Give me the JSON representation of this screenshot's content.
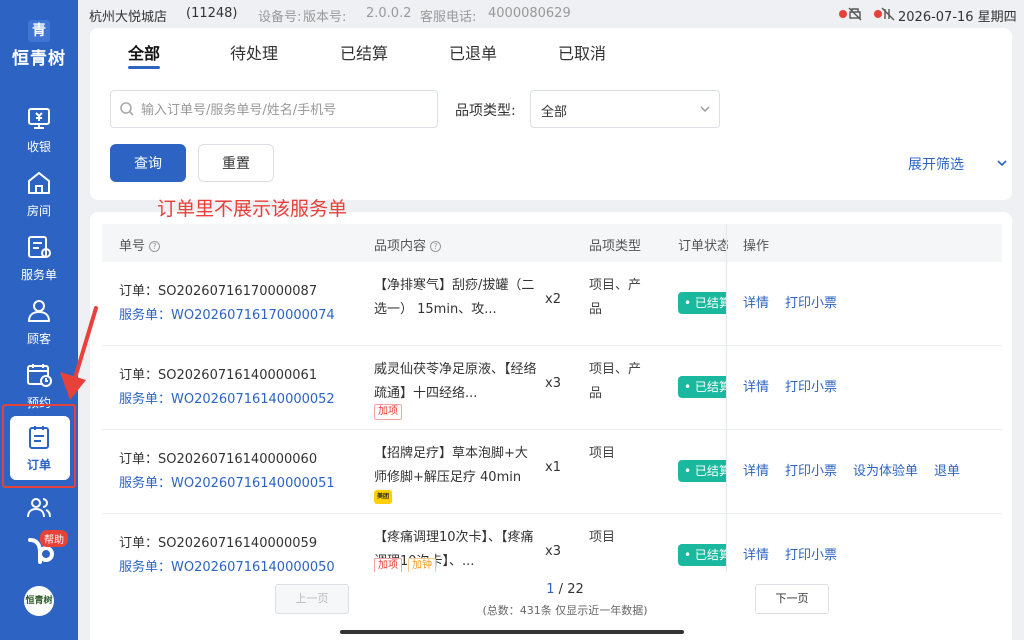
{
  "sidebar": {
    "logo_glyph": "青",
    "logo_name": "恒青树",
    "items": [
      {
        "label": "收银",
        "icon": "cashier-icon"
      },
      {
        "label": "房间",
        "icon": "home-icon"
      },
      {
        "label": "服务单",
        "icon": "service-order-icon"
      },
      {
        "label": "顾客",
        "icon": "customer-icon"
      },
      {
        "label": "预约",
        "icon": "calendar-icon"
      },
      {
        "label": "订单",
        "icon": "order-icon",
        "active": true
      },
      {
        "label": "",
        "icon": "staff-icon"
      }
    ],
    "help_badge": "帮助",
    "store_logo_text": "恒青树"
  },
  "statusbar": {
    "store": "杭州大悦城店",
    "store_code": "(11248)",
    "device_label": "设备号:",
    "version_label": "版本号:",
    "version": "2.0.0.2",
    "tel_label": "客服电话:",
    "tel": "4000080629",
    "datetime": "2026-07-16 星期四"
  },
  "tabs": [
    {
      "label": "全部",
      "active": true
    },
    {
      "label": "待处理"
    },
    {
      "label": "已结算"
    },
    {
      "label": "已退单"
    },
    {
      "label": "已取消"
    }
  ],
  "filters": {
    "search_placeholder": "输入订单号/服务单号/姓名/手机号",
    "category_label": "品项类型:",
    "category_value": "全部",
    "query_button": "查询",
    "reset_button": "重置",
    "expand_label": "展开筛选"
  },
  "annotation": "订单里不展示该服务单",
  "table": {
    "columns": [
      "单号",
      "品项内容",
      "品项类型",
      "订单状态",
      "操作"
    ],
    "rows": [
      {
        "order": "订单：SO20260716170000087",
        "service": "服务单：WO20260716170000074",
        "item": "【净排寒气】刮痧/拔罐（二选一） 15min、攻...",
        "qty": "x2",
        "type": "项目、产品",
        "status": "• 已结算",
        "tags": [],
        "ops": [
          "详情",
          "打印小票"
        ]
      },
      {
        "order": "订单：SO20260716140000061",
        "service": "服务单：WO20260716140000052",
        "item": "威灵仙茯苓净足原液、【经络疏通】十四经络...",
        "qty": "x3",
        "type": "项目、产品",
        "status": "• 已结算",
        "tags": [
          {
            "text": "加项",
            "color": "red"
          }
        ],
        "ops": [
          "详情",
          "打印小票"
        ]
      },
      {
        "order": "订单：SO20260716140000060",
        "service": "服务单：WO20260716140000051",
        "item": "【招牌足疗】草本泡脚+大师修脚+解压足疗 40min",
        "qty": "x1",
        "type": "项目",
        "status": "• 已结算",
        "tags": [],
        "meituan": "美团",
        "ops": [
          "详情",
          "打印小票",
          "设为体验单",
          "退单"
        ]
      },
      {
        "order": "订单：SO20260716140000059",
        "service": "服务单：WO20260716140000050",
        "item": "【疼痛调理10次卡】、【疼痛调理10次卡】、...",
        "qty": "x3",
        "type": "项目",
        "status": "• 已结算",
        "tags": [
          {
            "text": "加项",
            "color": "red"
          },
          {
            "text": "加钟",
            "color": "orange"
          }
        ],
        "ops": [
          "详情",
          "打印小票"
        ]
      }
    ]
  },
  "pager": {
    "prev": "上一页",
    "next": "下一页",
    "current": "1",
    "separator": " / ",
    "total_pages": "22",
    "total_text": "(总数：431条 仅显示近一年数据)"
  },
  "colors": {
    "primary": "#2d64c4",
    "annotation": "#e8413a",
    "status": "#1bb8a0"
  }
}
